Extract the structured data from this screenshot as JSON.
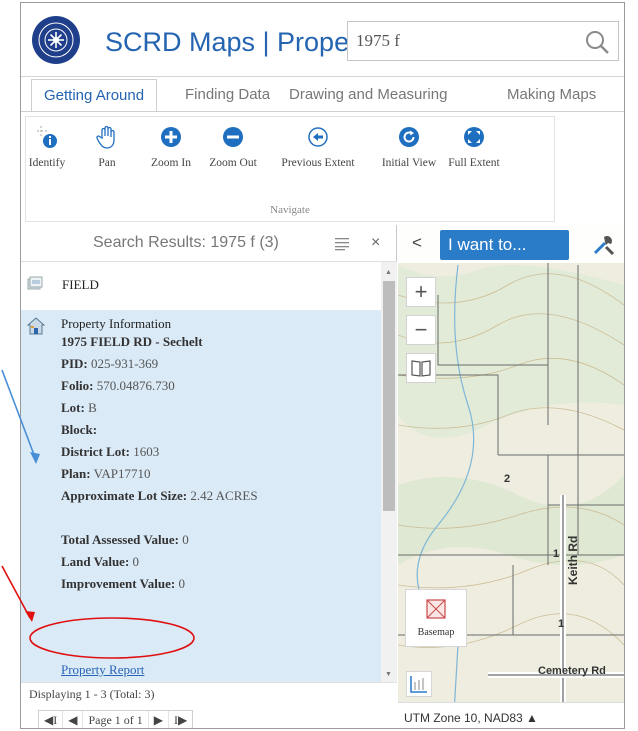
{
  "header": {
    "app_title": "SCRD Maps  |  Properties",
    "search_value": "1975 f",
    "logo_text": "SUNSHINE COAST REGIONAL DISTRICT"
  },
  "ribbon": {
    "tabs": [
      {
        "label": "Getting Around",
        "active": true
      },
      {
        "label": "Finding Data",
        "active": false
      },
      {
        "label": "Drawing and Measuring",
        "active": false
      },
      {
        "label": "Making Maps",
        "active": false
      }
    ],
    "tools": [
      {
        "label": "Identify",
        "icon": "identify-icon"
      },
      {
        "label": "Pan",
        "icon": "hand-icon"
      },
      {
        "label": "Zoom In",
        "icon": "zoom-in-icon"
      },
      {
        "label": "Zoom Out",
        "icon": "zoom-out-icon"
      },
      {
        "label": "Previous Extent",
        "icon": "previous-extent-icon"
      },
      {
        "label": "Initial View",
        "icon": "initial-view-icon"
      },
      {
        "label": "Full Extent",
        "icon": "full-extent-icon"
      }
    ],
    "group_label": "Navigate"
  },
  "results": {
    "title": "Search Results: 1975 f (3)",
    "close_glyph": "×",
    "layer_name": "FIELD",
    "property": {
      "heading": "Property Information",
      "address": "1975 FIELD RD - Sechelt",
      "pid_label": "PID:",
      "pid": "025-931-369",
      "folio_label": "Folio:",
      "folio": "570.04876.730",
      "lot_label": "Lot:",
      "lot": "B",
      "block_label": "Block:",
      "block": "",
      "district_lot_label": "District Lot:",
      "district_lot": "1603",
      "plan_label": "Plan:",
      "plan": "VAP17710",
      "lot_size_label": "Approximate Lot Size:",
      "lot_size": "2.42 ACRES",
      "assessed_label": "Total Assessed Value:",
      "assessed": "0",
      "land_label": "Land Value:",
      "land": "0",
      "improvement_label": "Improvement Value:",
      "improvement": "0"
    },
    "report_link": "Property Report",
    "footer": {
      "display_count": "Displaying 1 - 3 (Total: 3)",
      "page_text": "Page 1 of 1",
      "first_glyph": "◀I",
      "prev_glyph": "◀",
      "next_glyph": "▶",
      "last_glyph": "I▶"
    }
  },
  "map": {
    "collapse_glyph": "<",
    "i_want_to": "I want to...",
    "zoom_in_glyph": "+",
    "zoom_out_glyph": "−",
    "basemap_label": "Basemap",
    "road_keith": "Keith Rd",
    "road_cemetery": "Cemetery Rd",
    "parcel_label_1": "2",
    "parcel_label_2": "1",
    "parcel_label_3": "1",
    "status": "UTM Zone 10, NAD83 ▲"
  },
  "colors": {
    "brand_blue": "#2464b0",
    "button_blue": "#2a7cc9",
    "selected_row": "#dbeaf7",
    "annotation_blue": "#4a8fd6",
    "annotation_red": "#e01010"
  }
}
